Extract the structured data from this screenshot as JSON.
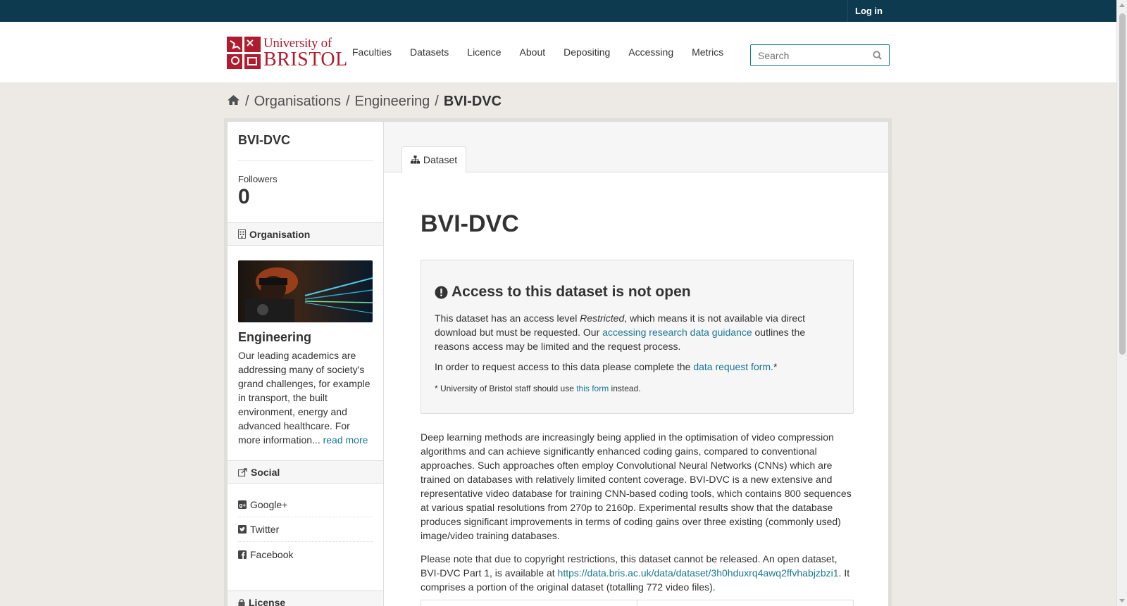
{
  "topbar": {
    "login": "Log in"
  },
  "logo": {
    "line1": "University of",
    "line2": "BRISTOL",
    "brand_color": "#b01c2e"
  },
  "nav": [
    "Faculties",
    "Datasets",
    "Licence",
    "About",
    "Depositing",
    "Accessing",
    "Metrics"
  ],
  "search": {
    "placeholder": "Search",
    "value": ""
  },
  "breadcrumb": {
    "home_icon": "home-icon",
    "items": [
      "Organisations",
      "Engineering"
    ],
    "current": "BVI-DVC"
  },
  "sidebar": {
    "title": "BVI-DVC",
    "followers_label": "Followers",
    "followers_count": "0",
    "org_heading": "Organisation",
    "org_name": "Engineering",
    "org_desc": "Our leading academics are addressing many of society's grand challenges, for example in transport, the built environment, energy and advanced healthcare. For more information...",
    "org_read_more": "read more",
    "social_heading": "Social",
    "social": [
      "Google+",
      "Twitter",
      "Facebook"
    ],
    "license_heading": "License"
  },
  "main": {
    "tab": "Dataset",
    "title": "BVI-DVC",
    "notice": {
      "title": "Access to this dataset is not open",
      "p1_a": "This dataset has an access level ",
      "p1_em": "Restricted",
      "p1_b": ", which means it is not available via direct download but must be requested. Our ",
      "p1_link": "accessing research data guidance",
      "p1_c": " outlines the reasons access may be limited and the request process.",
      "p2_a": "In order to request access to this data please complete the ",
      "p2_link": "data request form.",
      "p2_b": "*",
      "p3_a": "* University of Bristol staff should use ",
      "p3_link": "this form",
      "p3_b": " instead."
    },
    "desc1": "Deep learning methods are increasingly being applied in the optimisation of video compression algorithms and can achieve significantly enhanced coding gains, compared to conventional approaches. Such approaches often employ Convolutional Neural Networks (CNNs) which are trained on databases with relatively limited content coverage. BVI-DVC is a new extensive and representative video database for training CNN-based coding tools, which contains 800 sequences at various spatial resolutions from 270p to 2160p. Experimental results show that the database produces significant improvements in terms of coding gains over three existing (commonly used) image/video training databases.",
    "desc2_a": "Please note that due to copyright restrictions, this dataset cannot be released. An open dataset, BVI-DVC Part 1, is available at ",
    "desc2_link": "https://data.bris.ac.uk/data/dataset/3h0hduxrq4awq2ffvhabjzbzi1",
    "desc2_b": ". It comprises a portion of the original dataset (totalling 772 video files)."
  }
}
